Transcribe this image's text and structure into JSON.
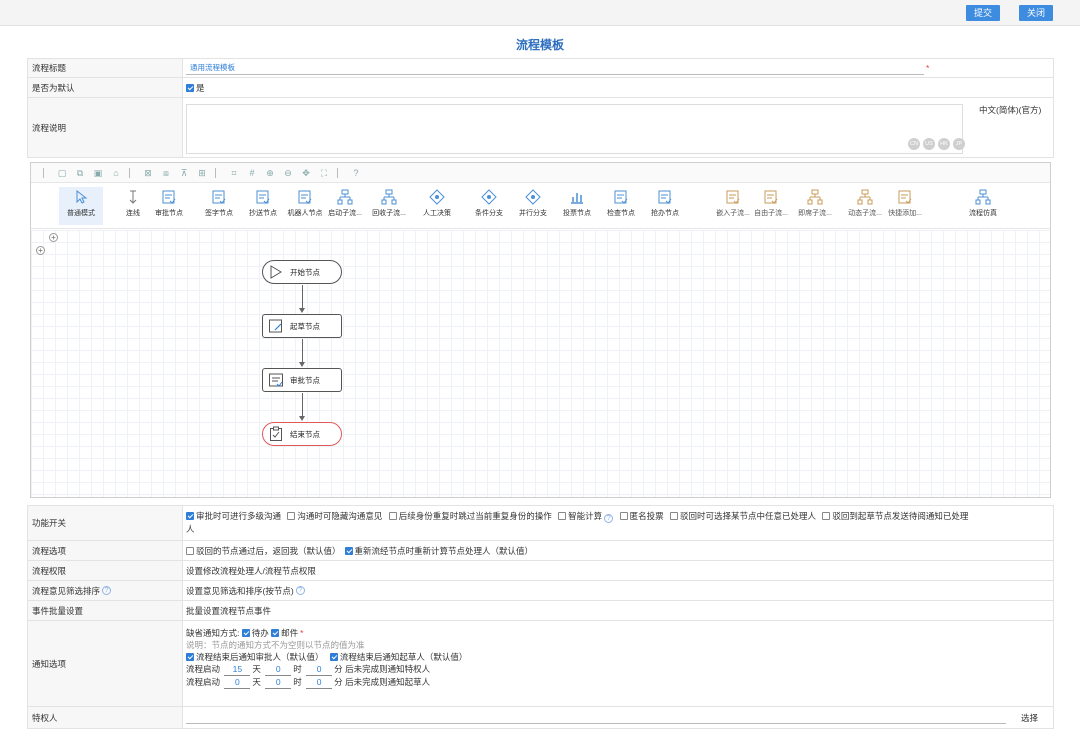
{
  "top": {
    "submit": "提交",
    "close": "关闭"
  },
  "form": {
    "title": "流程模板"
  },
  "rows": {
    "title": {
      "label": "流程标题",
      "value": "通用流程模板"
    },
    "default": {
      "label": "是否为默认",
      "value": "是"
    },
    "desc": {
      "label": "流程说明",
      "lang": "中文(简体)(官方)",
      "langs": [
        "CN",
        "US",
        "HK",
        "JP"
      ]
    }
  },
  "designer": {
    "tools": [
      {
        "label": "普通模式",
        "icon": "cursor-icon"
      },
      {
        "label": "连线",
        "icon": "connector-icon"
      },
      {
        "label": "审批节点",
        "icon": "review-node-icon"
      },
      {
        "label": "签字节点",
        "icon": "sign-node-icon"
      },
      {
        "label": "抄送节点",
        "icon": "cc-node-icon"
      },
      {
        "label": "机器人节点",
        "icon": "robot-node-icon"
      },
      {
        "label": "启动子流...",
        "icon": "start-subflow-icon"
      },
      {
        "label": "回收子流...",
        "icon": "recover-subflow-icon"
      },
      {
        "label": "人工决策",
        "icon": "manual-decision-icon"
      },
      {
        "label": "条件分支",
        "icon": "condition-branch-icon"
      },
      {
        "label": "并行分支",
        "icon": "parallel-branch-icon"
      },
      {
        "label": "投票节点",
        "icon": "vote-node-icon"
      },
      {
        "label": "检查节点",
        "icon": "check-node-icon"
      },
      {
        "label": "抢办节点",
        "icon": "grab-node-icon"
      },
      {
        "label": "嵌入子流...",
        "icon": "embed-subflow-icon"
      },
      {
        "label": "自由子流...",
        "icon": "free-subflow-icon"
      },
      {
        "label": "即席子流...",
        "icon": "adhoc-subflow-icon"
      },
      {
        "label": "动态子流...",
        "icon": "dynamic-subflow-icon"
      },
      {
        "label": "快捷添加...",
        "icon": "quick-add-icon"
      },
      {
        "label": "流程仿真",
        "icon": "simulation-icon"
      }
    ],
    "nodes": {
      "start": "开始节点",
      "draft": "起草节点",
      "review": "审批节点",
      "end": "结束节点"
    }
  },
  "switches": {
    "label": "功能开关",
    "items": [
      {
        "text": "审批时可进行多级沟通",
        "checked": true
      },
      {
        "text": "沟通时可隐藏沟通意见",
        "checked": false
      },
      {
        "text": "后续身份重复时跳过当前重复身份的操作",
        "checked": false
      },
      {
        "text": "智能计算",
        "checked": false
      },
      {
        "text": "匿名投票",
        "checked": false
      },
      {
        "text": "驳回时可选择某节点中任意已处理人",
        "checked": false
      },
      {
        "text": "驳回到起草节点发送待阅通知已处理",
        "checked": false
      }
    ],
    "wrap": "人"
  },
  "options": {
    "label": "流程选项",
    "items": [
      {
        "text": "驳回的节点通过后，返回我（默认值）",
        "checked": false
      },
      {
        "text": "重新流经节点时重新计算节点处理人（默认值）",
        "checked": true
      }
    ]
  },
  "perm": {
    "label": "流程权限",
    "value": "设置修改流程处理人/流程节点权限"
  },
  "opinion": {
    "label": "流程意见筛选排序",
    "value": "设置意见筛选和排序(按节点)"
  },
  "events": {
    "label": "事件批量设置",
    "value": "批量设置流程节点事件"
  },
  "notify": {
    "label": "通知选项",
    "method_label": "缺省通知方式:",
    "m1": "待办",
    "m2": "邮件",
    "note": "说明：节点的通知方式不为空则以节点的值为准",
    "c1": "流程结束后通知审批人（默认值）",
    "c2": "流程结束后通知起草人（默认值）",
    "line1": {
      "prefix": "流程启动",
      "d": "15",
      "dl": "天",
      "h": "0",
      "hl": "时",
      "m": "0",
      "ml": "分",
      "suffix": "后未完成则通知特权人"
    },
    "line2": {
      "prefix": "流程启动",
      "d": "0",
      "dl": "天",
      "h": "0",
      "hl": "时",
      "m": "0",
      "ml": "分",
      "suffix": "后未完成则通知起草人"
    }
  },
  "privileged": {
    "label": "特权人",
    "select": "选择"
  }
}
